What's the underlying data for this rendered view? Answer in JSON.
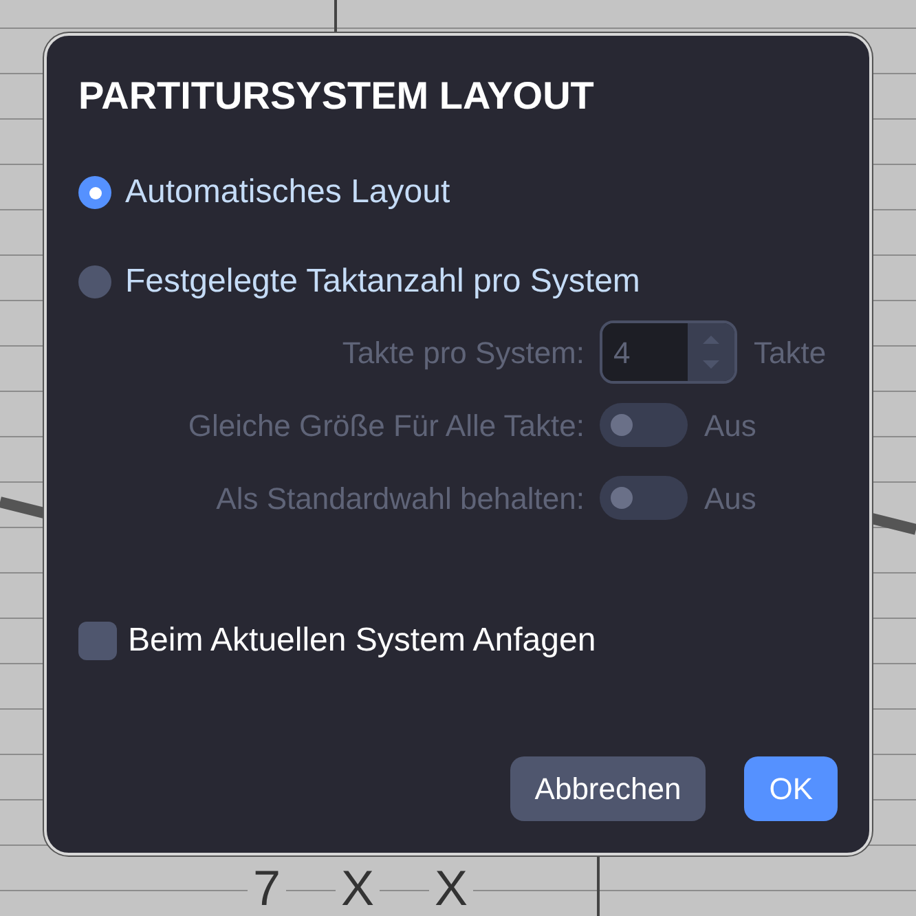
{
  "title": "PARTITURSYSTEM LAYOUT",
  "layout_options": [
    {
      "label": "Automatisches Layout",
      "selected": true
    },
    {
      "label": "Festgelegte Taktanzahl pro System",
      "selected": false
    }
  ],
  "settings": [
    {
      "kind": "stepper",
      "label": "Takte pro System:",
      "value": "4",
      "unit": "Takte",
      "disabled": true
    },
    {
      "kind": "toggle",
      "label": "Gleiche Größe Für Alle Takte:",
      "on": false,
      "state_text": "Aus",
      "disabled": true
    },
    {
      "kind": "toggle",
      "label": "Als Standardwahl behalten:",
      "on": false,
      "state_text": "Aus",
      "disabled": true
    }
  ],
  "start_at_current": {
    "label": "Beim Aktuellen System Anfagen",
    "checked": false
  },
  "buttons": [
    {
      "label": "Abbrechen",
      "kind": "secondary"
    },
    {
      "label": "OK",
      "kind": "primary"
    }
  ],
  "background_tab": {
    "notes": [
      "7",
      "X",
      "X"
    ]
  }
}
